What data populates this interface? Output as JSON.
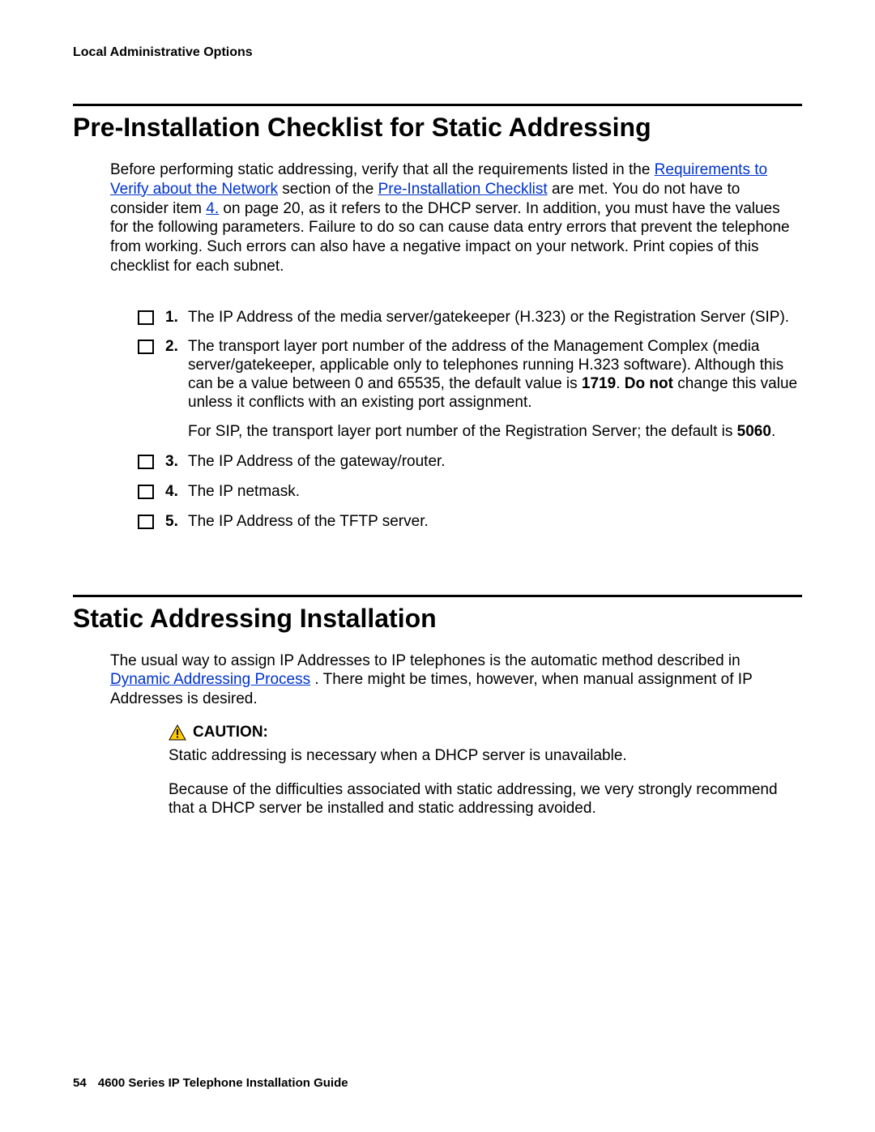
{
  "running_header": "Local Administrative Options",
  "section1": {
    "title": "Pre-Installation Checklist for Static Addressing",
    "intro_a": "Before performing static addressing, verify that all the requirements listed in the ",
    "link1": "Requirements to Verify about the Network",
    "intro_b": " section of the ",
    "link2": "Pre-Installation Checklist",
    "intro_c": " are met. You do not have to consider item ",
    "link3": "4.",
    "intro_d": " on page 20, as it refers to the DHCP server. In addition, you must have the values for the following parameters. Failure to do so can cause data entry errors that prevent the telephone from working. Such errors can also have a negative impact on your network. Print copies of this checklist for each subnet."
  },
  "checklist": [
    {
      "num": "1.",
      "paras": [
        {
          "text": "The IP Address of the media server/gatekeeper (H.323) or the Registration Server (SIP)."
        }
      ]
    },
    {
      "num": "2.",
      "paras": [
        {
          "segments": [
            {
              "t": "The transport layer port number of the address of the Management Complex (media server/gatekeeper, applicable only to telephones running H.323 software). Although this can be a value between 0 and 65535, the default value is "
            },
            {
              "t": "1719",
              "b": true
            },
            {
              "t": ". "
            },
            {
              "t": "Do not",
              "b": true
            },
            {
              "t": " change this value unless it conflicts with an existing port assignment."
            }
          ]
        },
        {
          "segments": [
            {
              "t": "For SIP, the transport layer port number of the Registration Server; the default is "
            },
            {
              "t": "5060",
              "b": true
            },
            {
              "t": "."
            }
          ]
        }
      ]
    },
    {
      "num": "3.",
      "paras": [
        {
          "text": "The IP Address of the gateway/router."
        }
      ]
    },
    {
      "num": "4.",
      "paras": [
        {
          "text": "The IP netmask."
        }
      ]
    },
    {
      "num": "5.",
      "paras": [
        {
          "text": "The IP Address of the TFTP server."
        }
      ]
    }
  ],
  "section2": {
    "title": "Static Addressing Installation",
    "intro_a": "The usual way to assign IP Addresses to IP telephones is the automatic method described in ",
    "link1": "Dynamic Addressing Process",
    "intro_b": ". There might be times, however, when manual assignment of IP Addresses is desired."
  },
  "caution": {
    "label": "CAUTION:",
    "p1": "Static addressing is necessary when a DHCP server is unavailable.",
    "p2": "Because of the difficulties associated with static addressing, we very strongly recommend that a DHCP server be installed and static addressing avoided."
  },
  "footer": {
    "page_num": "54",
    "doc_title": "4600 Series IP Telephone Installation Guide"
  }
}
